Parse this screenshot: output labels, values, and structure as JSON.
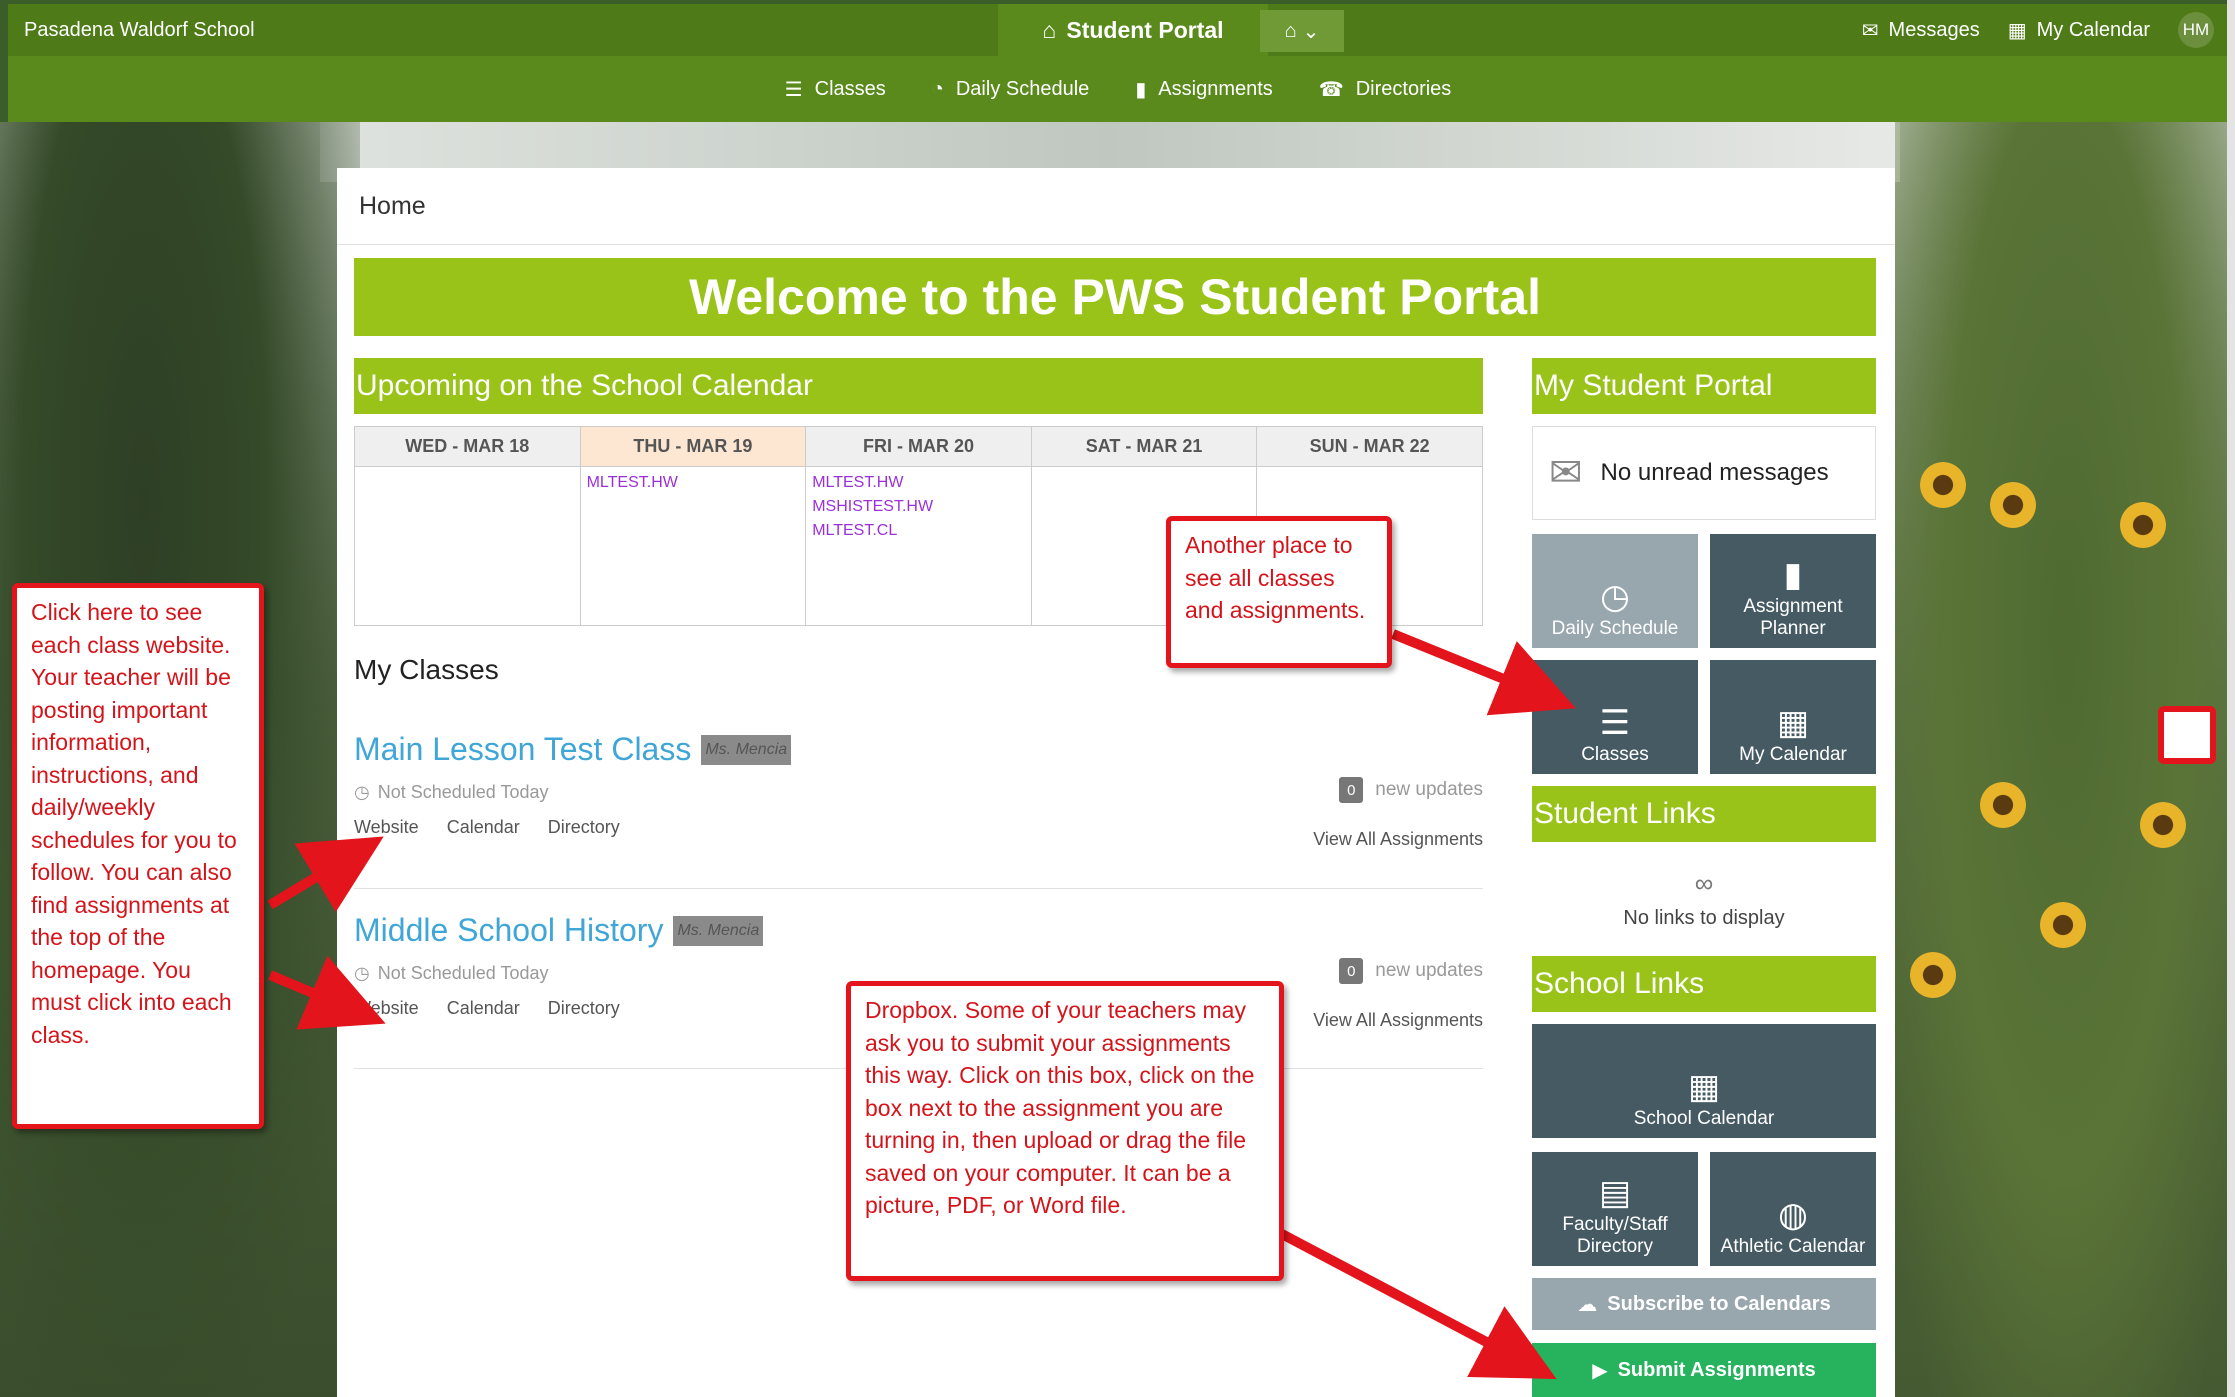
{
  "topbar": {
    "school_name": "Pasadena Waldorf School",
    "portal_label": "Student Portal",
    "messages_label": "Messages",
    "my_calendar_label": "My Calendar",
    "avatar_initials": "HM",
    "accent": "#4e7a17"
  },
  "subnav": {
    "items": [
      {
        "label": "Classes",
        "icon": "list-icon"
      },
      {
        "label": "Daily Schedule",
        "icon": "clock-icon"
      },
      {
        "label": "Assignments",
        "icon": "bookmark-icon"
      },
      {
        "label": "Directories",
        "icon": "phone-icon"
      }
    ]
  },
  "breadcrumb": "Home",
  "welcome": "Welcome to the PWS Student Portal",
  "calendar": {
    "heading": "Upcoming on the School Calendar",
    "days": [
      {
        "label": "WED - MAR 18",
        "events": []
      },
      {
        "label": "THU - MAR 19",
        "events": [
          "MLTEST.HW"
        ]
      },
      {
        "label": "FRI - MAR 20",
        "events": [
          "MLTEST.HW",
          "MSHISTEST.HW",
          "MLTEST.CL"
        ]
      },
      {
        "label": "SAT - MAR 21",
        "events": []
      },
      {
        "label": "SUN - MAR 22",
        "events": []
      }
    ]
  },
  "my_classes": {
    "heading": "My Classes",
    "classes": [
      {
        "title": "Main Lesson Test Class",
        "teacher": "Ms. Mencia",
        "schedule": "Not Scheduled Today",
        "links": [
          "Website",
          "Calendar",
          "Directory"
        ],
        "update_count": "0",
        "updates_label": "new updates",
        "view_all": "View All Assignments"
      },
      {
        "title": "Middle School History",
        "teacher": "Ms. Mencia",
        "schedule": "Not Scheduled Today",
        "links": [
          "Website",
          "Calendar",
          "Directory"
        ],
        "update_count": "0",
        "updates_label": "new updates",
        "view_all": "View All Assignments"
      }
    ]
  },
  "sidebar": {
    "my_portal_heading": "My Student Portal",
    "messages_text": "No unread messages",
    "tiles": [
      {
        "label": "Daily Schedule",
        "icon": "clock-icon"
      },
      {
        "label": "Assignment Planner",
        "icon": "bookmark-icon"
      },
      {
        "label": "Classes",
        "icon": "list-icon"
      },
      {
        "label": "My Calendar",
        "icon": "calendar-icon"
      }
    ],
    "student_links_heading": "Student Links",
    "no_links_text": "No links to display",
    "school_links_heading": "School Links",
    "school_tiles": [
      {
        "label": "School Calendar",
        "icon": "calendar-icon"
      },
      {
        "label": "Faculty/Staff Directory",
        "icon": "contact-book-icon"
      },
      {
        "label": "Athletic Calendar",
        "icon": "basketball-icon"
      }
    ],
    "subscribe_label": "Subscribe to Calendars",
    "submit_label": "Submit Assignments"
  },
  "callouts": {
    "class_website": "Click here to see each class website. Your teacher will be posting important information, instructions, and daily/weekly schedules for you to follow. You can also find assignments at the top of the homepage. You must click into each class.",
    "another_place": "Another place to see all classes and assignments.",
    "dropbox": "Dropbox. Some of your teachers may ask you to submit your assignments this way. Click on this box, click on the box next to the assignment you are turning in, then upload or drag the file saved on your computer. It can be a picture, PDF, or Word file."
  },
  "colors": {
    "green_header": "#9ac31a",
    "tile_dark": "#465a63",
    "tile_light": "#98a6ad",
    "submit_green": "#27b25e",
    "callout_red": "#e3141b",
    "link_blue": "#3fa6d7",
    "event_purple": "#9b30d9"
  }
}
